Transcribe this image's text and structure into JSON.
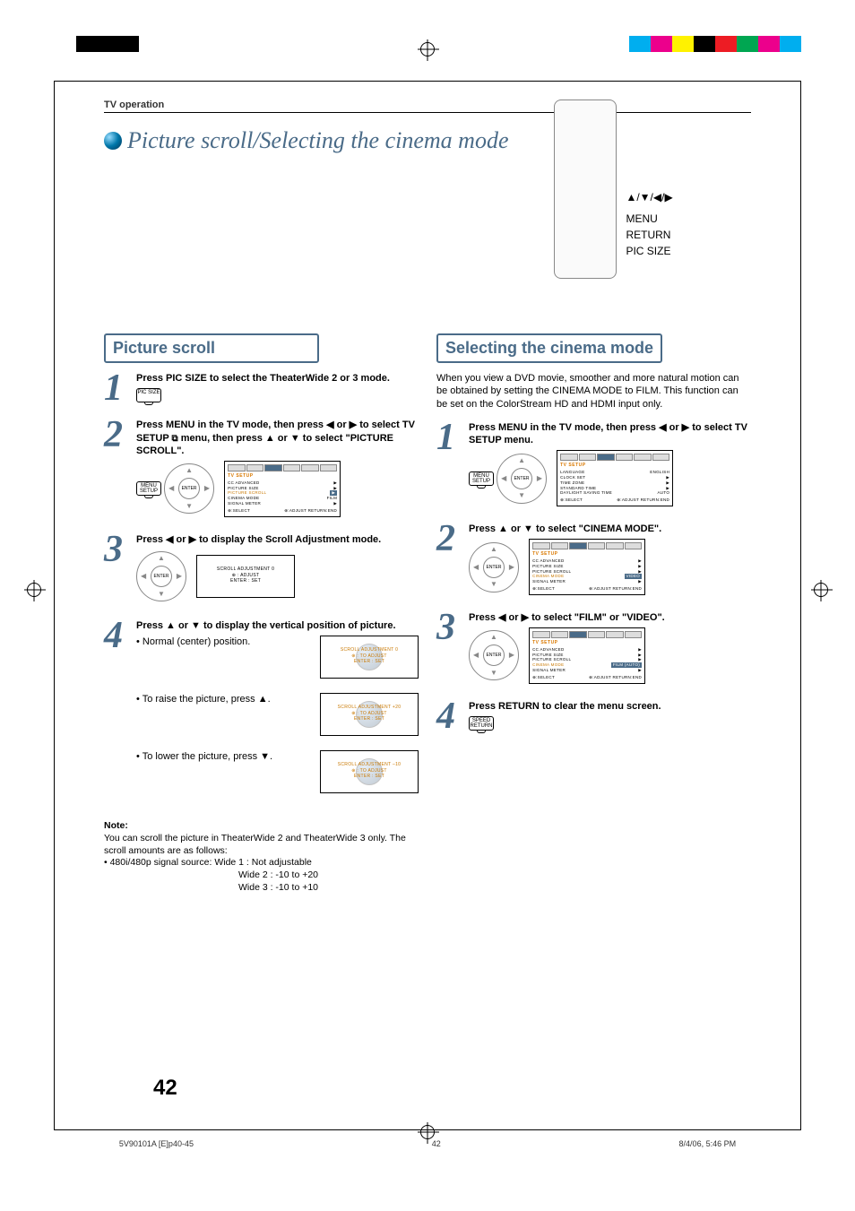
{
  "header": {
    "section": "TV operation"
  },
  "title": "Picture scroll/Selecting the cinema mode",
  "remote_callouts": {
    "arrows": "▲/▼/◀/▶",
    "menu": "MENU",
    "return": "RETURN",
    "picsize": "PIC SIZE"
  },
  "left": {
    "heading": "Picture scroll",
    "steps": [
      {
        "num": "1",
        "text_bold": "Press PIC SIZE to select the TheaterWide 2 or 3 mode.",
        "button_label": "PIC SIZE"
      },
      {
        "num": "2",
        "text_parts": {
          "a": "Press MENU in the TV mode, then press ◀ or ▶ to select TV SETUP ",
          "b": " menu, then press ▲ or ▼ to select \"PICTURE SCROLL\".",
          "button_label": "MENU SETUP"
        },
        "osd": {
          "title": "TV SETUP",
          "rows": [
            {
              "label": "CC ADVANCED",
              "val": "▶"
            },
            {
              "label": "PICTURE SIZE",
              "val": "▶"
            },
            {
              "label": "PICTURE SCROLL",
              "val": "▶",
              "hl": true
            },
            {
              "label": "CINEMA MODE",
              "val": "FILM"
            },
            {
              "label": "SIGNAL METER",
              "val": "▶"
            }
          ],
          "foot_left": "⊕:SELECT",
          "foot_right": "⊕:ADJUST  RETURN:END"
        }
      },
      {
        "num": "3",
        "text_bold": "Press ◀ or ▶ to display the Scroll Adjustment mode.",
        "scroll_osd": {
          "line1": "SCROLL ADJUSTMENT     0",
          "line2": "⊕ : ADJUST",
          "line3": "ENTER : SET"
        }
      },
      {
        "num": "4",
        "text_bold": "Press ▲ or ▼ to display the vertical position of picture.",
        "subs": [
          {
            "text": "• Normal (center) position.",
            "osd": {
              "line1": "SCROLL ADJUSTMENT        0",
              "line2": "⊕ : TO ADJUST",
              "line3": "ENTER : SET"
            }
          },
          {
            "text": "• To raise the picture, press ▲.",
            "osd": {
              "line1": "SCROLL ADJUSTMENT    +20",
              "line2": "⊕ : TO ADJUST",
              "line3": "ENTER : SET"
            }
          },
          {
            "text": "• To lower the picture, press ▼.",
            "osd": {
              "line1": "SCROLL ADJUSTMENT    –10",
              "line2": "⊕ : TO ADJUST",
              "line3": "ENTER : SET"
            }
          }
        ]
      }
    ],
    "note": {
      "label": "Note:",
      "body1": "You can scroll the picture in TheaterWide 2 and TheaterWide 3 only. The scroll amounts are as follows:",
      "body2": "• 480i/480p signal source:  Wide 1 : Not adjustable",
      "body3": "Wide 2 : -10 to +20",
      "body4": "Wide 3 : -10 to +10"
    }
  },
  "right": {
    "heading": "Selecting the cinema mode",
    "intro": "When you view a DVD movie, smoother and more natural motion can be obtained by setting the CINEMA MODE to FILM. This function can be set on the ColorStream HD and HDMI input only.",
    "steps": [
      {
        "num": "1",
        "text_bold": "Press MENU in the TV mode, then press ◀ or ▶ to select TV SETUP  menu.",
        "button_label": "MENU SETUP",
        "osd": {
          "title": "TV SETUP",
          "rows": [
            {
              "label": "LANGUAGE",
              "val": "ENGLISH"
            },
            {
              "label": "CLOCK SET",
              "val": "▶"
            },
            {
              "label": "TIME ZONE",
              "val": "▶"
            },
            {
              "label": "STANDARD TIME",
              "val": "▶"
            },
            {
              "label": "DAYLIGHT SAVING TIME",
              "val": "AUTO"
            }
          ],
          "foot_left": "⊕:SELECT",
          "foot_right": "⊕:ADJUST  RETURN:END"
        }
      },
      {
        "num": "2",
        "text_bold": "Press ▲ or ▼ to select \"CINEMA MODE\".",
        "osd": {
          "title": "TV SETUP",
          "rows": [
            {
              "label": "CC ADVANCED",
              "val": "▶"
            },
            {
              "label": "PICTURE SIZE",
              "val": "▶"
            },
            {
              "label": "PICTURE SCROLL",
              "val": "▶"
            },
            {
              "label": "CINEMA MODE",
              "val": "VIDEO",
              "hl": true
            },
            {
              "label": "SIGNAL METER",
              "val": "▶"
            }
          ],
          "foot_left": "⊕:SELECT",
          "foot_right": "⊕:ADJUST  RETURN:END"
        }
      },
      {
        "num": "3",
        "text_bold": "Press ◀ or ▶ to select \"FILM\" or \"VIDEO\".",
        "osd": {
          "title": "TV SETUP",
          "rows": [
            {
              "label": "CC ADVANCED",
              "val": "▶"
            },
            {
              "label": "PICTURE SIZE",
              "val": "▶"
            },
            {
              "label": "PICTURE SCROLL",
              "val": "▶"
            },
            {
              "label": "CINEMA MODE",
              "val": "FILM (AUTO)",
              "hl": true
            },
            {
              "label": "SIGNAL METER",
              "val": "▶"
            }
          ],
          "foot_left": "⊕:SELECT",
          "foot_right": "⊕:ADJUST  RETURN:END"
        }
      },
      {
        "num": "4",
        "text_bold": "Press RETURN to clear the menu screen.",
        "button_label": "SPEED RETURN"
      }
    ]
  },
  "pagenum": "42",
  "footer": {
    "left": "5V90101A [E]p40-45",
    "center": "42",
    "right": "8/4/06, 5:46 PM"
  },
  "colorbars": [
    "#00aeef",
    "#ec008c",
    "#fff200",
    "#000000",
    "#ed1c24",
    "#00a651",
    "#ec008c",
    "#00aeef"
  ]
}
